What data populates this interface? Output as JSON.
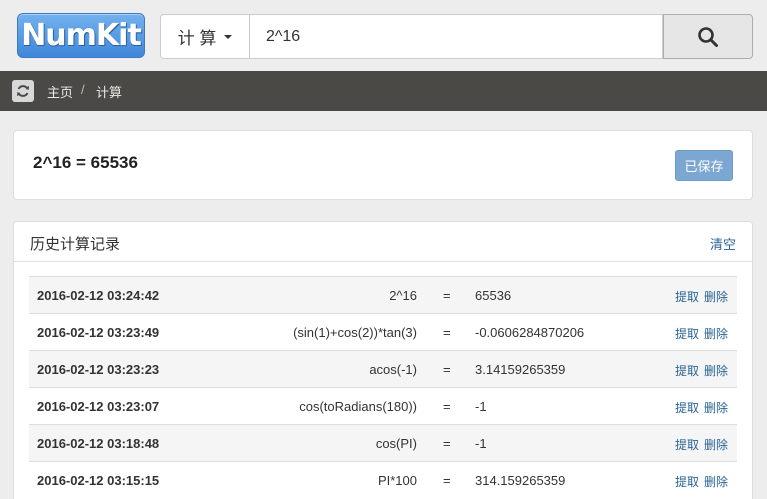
{
  "header": {
    "logo_text": "NumKit",
    "dropdown_label": "计 算",
    "search_value": "2^16",
    "search_icon": "search-icon"
  },
  "breadcrumb": {
    "refresh_icon": "refresh-icon",
    "home": "主页",
    "separator": "/",
    "current": "计算"
  },
  "result": {
    "text": "2^16 = 65536",
    "saved_label": "已保存"
  },
  "history": {
    "title": "历史计算记录",
    "clear_label": "清空",
    "rows": [
      {
        "time": "2016-02-12 03:24:42",
        "expr": "2^16",
        "eq": "=",
        "result": "65536",
        "extract": "提取",
        "delete": "删除"
      },
      {
        "time": "2016-02-12 03:23:49",
        "expr": "(sin(1)+cos(2))*tan(3)",
        "eq": "=",
        "result": "-0.0606284870206",
        "extract": "提取",
        "delete": "删除"
      },
      {
        "time": "2016-02-12 03:23:23",
        "expr": "acos(-1)",
        "eq": "=",
        "result": "3.14159265359",
        "extract": "提取",
        "delete": "删除"
      },
      {
        "time": "2016-02-12 03:23:07",
        "expr": "cos(toRadians(180))",
        "eq": "=",
        "result": "-1",
        "extract": "提取",
        "delete": "删除"
      },
      {
        "time": "2016-02-12 03:18:48",
        "expr": "cos(PI)",
        "eq": "=",
        "result": "-1",
        "extract": "提取",
        "delete": "删除"
      },
      {
        "time": "2016-02-12 03:15:15",
        "expr": "PI*100",
        "eq": "=",
        "result": "314.159265359",
        "extract": "提取",
        "delete": "删除"
      }
    ]
  }
}
